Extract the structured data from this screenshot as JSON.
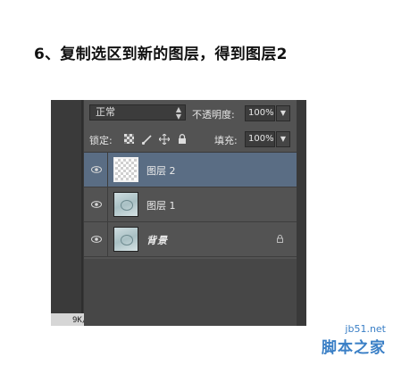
{
  "heading": "6、复制选区到新的图层，得到图层2",
  "options": {
    "blend_mode": "正常",
    "opacity_label": "不透明度:",
    "opacity_value": "100%",
    "lock_label": "锁定:",
    "fill_label": "填充:",
    "fill_value": "100%"
  },
  "layers": [
    {
      "name": "图层 2",
      "selected": true,
      "thumbnail": "transparent"
    },
    {
      "name": "图层 1",
      "selected": false,
      "thumbnail": "image"
    },
    {
      "name": "背景",
      "selected": false,
      "thumbnail": "image",
      "locked": true
    }
  ],
  "status_text": "9K/",
  "watermark": {
    "url": "jb51.net",
    "name": "脚本之家"
  },
  "colors": {
    "panel": "#535353",
    "selected_layer": "#5a6d84",
    "watermark": "#3a7fc6"
  }
}
